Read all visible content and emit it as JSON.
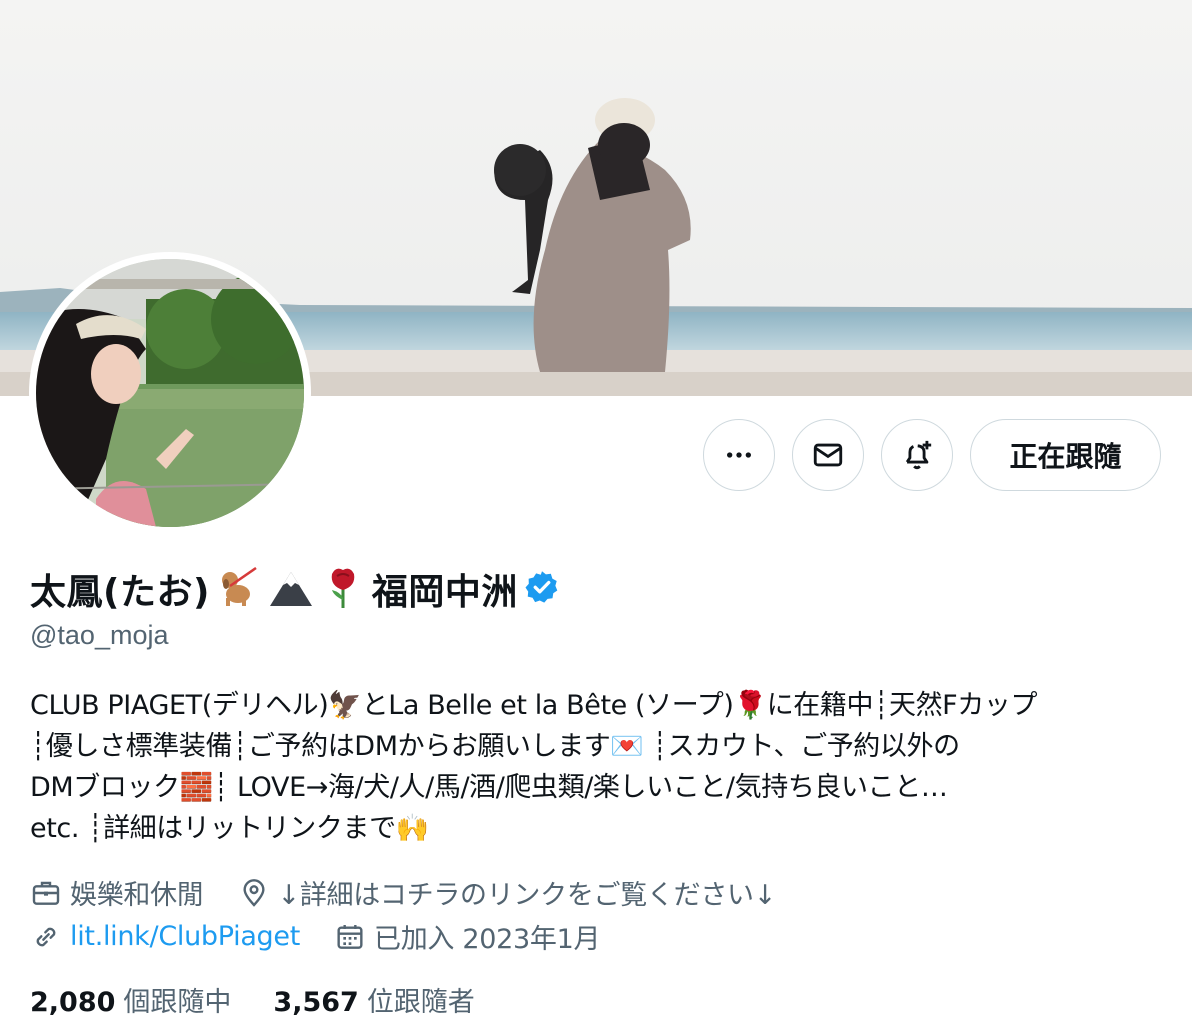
{
  "profile": {
    "name_text": "太鳳(たお)",
    "name_suffix": "福岡中洲",
    "handle": "@tao_moja",
    "bio_lines": [
      "CLUB PIAGET(デリヘル)🦅とLa Belle et la Bête (ソープ)🌹に在籍中┊天然Fカップ",
      "┊優しさ標準装備┊ご予約はDMからお願いします💌 ┊スカウト、ご予約以外の",
      "DMブロック🧱┊ LOVE→海/犬/人/馬/酒/爬虫類/楽しいこと/気持ち良いこと…",
      "etc. ┊詳細はリットリンクまで🙌"
    ],
    "category": "娛樂和休閒",
    "location": "↓詳細はコチラのリンクをご覧ください↓",
    "website": "lit.link/ClubPiaget",
    "joined": "已加入 2023年1月",
    "following_count": "2,080",
    "following_label": "個跟隨中",
    "followers_count": "3,567",
    "followers_label": "位跟隨者"
  },
  "actions": {
    "follow_label": "正在跟隨"
  },
  "icons": [
    "more-icon",
    "mail-icon",
    "bell-plus-icon",
    "verified-icon",
    "briefcase-icon",
    "location-pin-icon",
    "link-icon",
    "calendar-icon"
  ],
  "colors": {
    "accent": "#1d9bf0",
    "secondary_text": "#536471",
    "border": "#cfd9de"
  }
}
